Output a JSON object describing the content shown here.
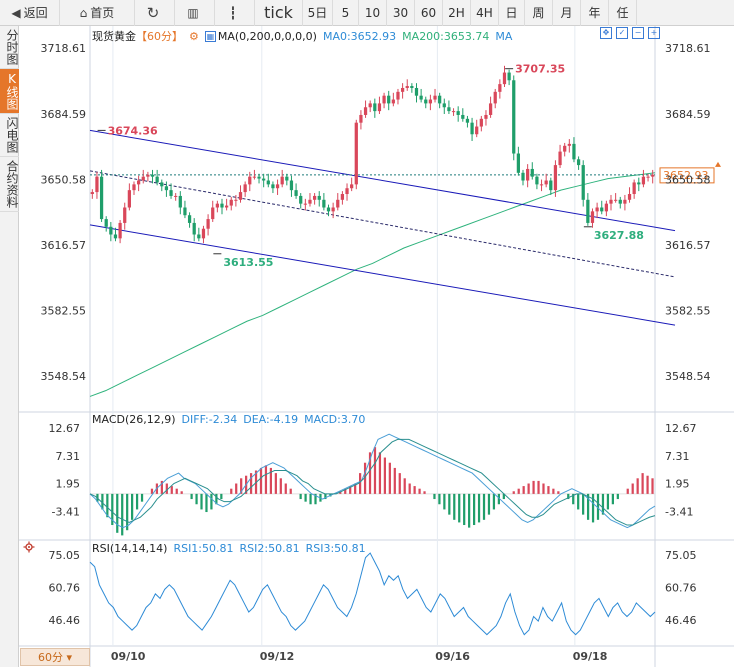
{
  "toolbar": {
    "back": "返回",
    "home": "首页",
    "refresh_icon": "refresh-icon",
    "periods": [
      "tick",
      "5日",
      "5",
      "10",
      "30",
      "60",
      "2H",
      "4H",
      "日",
      "周",
      "月",
      "年",
      "任"
    ]
  },
  "sidetabs": [
    "分时图",
    "K线图",
    "闪电图",
    "合约资料"
  ],
  "period_chip": "60分 ▾",
  "legend": {
    "instrument": "现货黄金",
    "period": "【60分】",
    "ma_label": "MA(0,200,0,0,0,0)",
    "ma0": "MA0:3652.93",
    "ma200": "MA200:3653.74",
    "ma_tail": "MA",
    "macd_label": "MACD(26,12,9)",
    "diff": "DIFF:-2.34",
    "dea": "DEA:-4.19",
    "macd_val": "MACD:3.70",
    "rsi_label": "RSI(14,14,14)",
    "rsi1": "RSI1:50.81",
    "rsi2": "RSI2:50.81",
    "rsi3": "RSI3:50.81"
  },
  "colors": {
    "up": "#d9475a",
    "down": "#1f9e6a",
    "ma200": "#2fb37d",
    "channel": "#1a1ab8",
    "diff": "#4a9ed6",
    "dea": "#2a8f8f",
    "rsi": "#2e8bd6",
    "price_line": "#1c7a7a",
    "current_tag": "#e5762a"
  },
  "chart_data": [
    {
      "type": "candlestick",
      "title": "现货黄金 60分",
      "price_axis_ticks": [
        3718.61,
        3684.59,
        3650.58,
        3616.57,
        3582.55,
        3548.54
      ],
      "ylim": [
        3532,
        3726
      ],
      "date_labels": [
        "09/10",
        "09/12",
        "09/16",
        "09/18"
      ],
      "date_label_bars": [
        6,
        45,
        91,
        127
      ],
      "bar_count": 148,
      "closes": [
        3644,
        3652,
        3630,
        3626,
        3622,
        3620,
        3628,
        3636,
        3645,
        3648,
        3650,
        3652,
        3653,
        3652,
        3649,
        3647,
        3645,
        3642,
        3642,
        3636,
        3632,
        3628,
        3622,
        3620,
        3625,
        3630,
        3636,
        3638,
        3636,
        3637,
        3640,
        3640,
        3644,
        3648,
        3652,
        3652,
        3651,
        3650,
        3648,
        3646,
        3648,
        3652,
        3650,
        3645,
        3642,
        3638,
        3638,
        3640,
        3642,
        3640,
        3636,
        3634,
        3636,
        3640,
        3643,
        3646,
        3648,
        3680,
        3684,
        3688,
        3690,
        3686,
        3690,
        3694,
        3690,
        3692,
        3696,
        3698,
        3699,
        3698,
        3694,
        3692,
        3690,
        3692,
        3694,
        3690,
        3688,
        3686,
        3686,
        3684,
        3682,
        3680,
        3674,
        3678,
        3682,
        3684,
        3690,
        3696,
        3700,
        3706,
        3702,
        3664,
        3654,
        3650,
        3656,
        3652,
        3648,
        3648,
        3650,
        3645,
        3658,
        3665,
        3668,
        3669,
        3661,
        3658,
        3640,
        3628,
        3634,
        3636,
        3634,
        3638,
        3640,
        3640,
        3638,
        3640,
        3643,
        3649,
        3648,
        3652,
        3652,
        3653
      ],
      "series_close_note": "closes are approximate hourly closes read from the candles",
      "annotations": [
        {
          "label": "3674.36",
          "kind": "high"
        },
        {
          "label": "3613.55",
          "kind": "low"
        },
        {
          "label": "3707.35",
          "kind": "high"
        },
        {
          "label": "3627.88",
          "kind": "low"
        }
      ],
      "current_price": "3652.93",
      "ma200": [
        3538,
        3541,
        3545,
        3549,
        3553,
        3557,
        3561,
        3565,
        3569,
        3573,
        3577,
        3580,
        3584,
        3588,
        3592,
        3596,
        3600,
        3604,
        3607,
        3611,
        3615,
        3618,
        3621,
        3624,
        3627,
        3630,
        3633,
        3636,
        3639,
        3642,
        3645,
        3647,
        3649,
        3651,
        3652,
        3653,
        3654
      ],
      "channel": {
        "upper": [
          3676,
          3624
        ],
        "lower": [
          3627,
          3575
        ],
        "middle": [
          3655,
          3600
        ]
      }
    },
    {
      "type": "bar",
      "title": "MACD(26,12,9)",
      "yticks": [
        12.67,
        7.31,
        1.95,
        -3.41
      ],
      "ylim": [
        -8.5,
        15
      ],
      "values": [
        0,
        -1.5,
        -3,
        -4.5,
        -6,
        -7.5,
        -8,
        -7,
        -5,
        -3,
        -1.5,
        0,
        1,
        2,
        2.5,
        2,
        1.5,
        1,
        0.5,
        0,
        -1,
        -2,
        -3,
        -3.5,
        -3,
        -2,
        -1,
        0,
        1,
        2,
        3,
        3.5,
        4,
        4.5,
        5,
        5.5,
        5,
        4,
        3,
        2,
        1,
        0,
        -1,
        -1.5,
        -2,
        -2,
        -1.5,
        -1,
        -0.5,
        0,
        0.5,
        1,
        1.5,
        2,
        4,
        6,
        8,
        9,
        8,
        7,
        6,
        5,
        4,
        3,
        2,
        1.5,
        1,
        0.5,
        0,
        -1,
        -2,
        -3,
        -4,
        -5,
        -5.5,
        -6,
        -6.5,
        -6,
        -5.5,
        -5,
        -4,
        -3,
        -2,
        -1,
        0,
        0.5,
        1,
        1.5,
        2,
        2.5,
        2.5,
        2,
        1.5,
        1,
        0.5,
        0,
        -1,
        -2,
        -3,
        -4,
        -5,
        -5.5,
        -5,
        -4,
        -3,
        -2,
        -1,
        0,
        1,
        2,
        3,
        4,
        3.5,
        3
      ],
      "diff": [
        0,
        -1,
        -2.5,
        -4,
        -5,
        -6,
        -6.5,
        -6,
        -5,
        -3.5,
        -2,
        -0.5,
        1,
        2,
        3,
        3.5,
        4,
        3,
        2.5,
        2,
        1,
        0,
        -1,
        -2,
        -2.5,
        -2,
        -1,
        0,
        1.5,
        3,
        4,
        5,
        5.5,
        6,
        5.5,
        5,
        4,
        3,
        2,
        1,
        0,
        -0.5,
        -1,
        -0.5,
        0,
        0.5,
        1,
        1.5,
        2,
        2.5,
        5,
        8,
        10.5,
        11,
        11.5,
        11,
        10.5,
        10,
        9.5,
        9,
        8.5,
        8,
        7.5,
        7,
        6.5,
        6,
        5.5,
        5,
        4.5,
        4,
        3,
        2,
        1,
        0,
        -1,
        -2,
        -3,
        -4,
        -5,
        -5.5,
        -5,
        -4,
        -3,
        -2,
        -1,
        0,
        0.5,
        1,
        0.5,
        0,
        -1,
        -2,
        -3,
        -4,
        -5,
        -5.5,
        -6,
        -6.5,
        -6,
        -5,
        -4,
        -3,
        -2.34
      ],
      "dea": [
        0,
        -0.5,
        -1.5,
        -2.5,
        -3.5,
        -4.5,
        -5,
        -5.5,
        -5,
        -4.5,
        -3.5,
        -2.5,
        -1,
        0,
        1,
        2,
        2.5,
        3,
        2.5,
        2,
        1.5,
        1,
        0,
        -1,
        -1.5,
        -1.5,
        -1,
        -0.5,
        0.5,
        1.5,
        2.5,
        3.5,
        4,
        4.5,
        4.5,
        4.5,
        4,
        3.5,
        2.5,
        2,
        1,
        0.5,
        0,
        0,
        0,
        0.5,
        1,
        1.5,
        2,
        3,
        4.5,
        6,
        8,
        9,
        10,
        10.5,
        10.5,
        10.5,
        10,
        9.5,
        9,
        8.5,
        8,
        7.5,
        7,
        6.5,
        6,
        5.5,
        5,
        4.5,
        4,
        3,
        2,
        1,
        0,
        -1,
        -2,
        -3,
        -4,
        -4.5,
        -4.5,
        -4,
        -3,
        -2,
        -1.5,
        -1,
        -0.5,
        0,
        0,
        -0.5,
        -1,
        -2,
        -3,
        -4,
        -5,
        -5.5,
        -6,
        -6,
        -5.5,
        -5,
        -4.5,
        -4.19
      ]
    },
    {
      "type": "line",
      "title": "RSI(14,14,14)",
      "yticks": [
        75.05,
        60.76,
        46.46
      ],
      "ylim": [
        35,
        80
      ],
      "values": [
        72,
        70,
        62,
        58,
        54,
        52,
        48,
        46,
        44,
        42,
        44,
        48,
        52,
        54,
        58,
        56,
        60,
        62,
        60,
        56,
        52,
        48,
        46,
        44,
        42,
        45,
        48,
        52,
        56,
        60,
        64,
        62,
        58,
        54,
        50,
        52,
        56,
        60,
        62,
        58,
        54,
        50,
        48,
        44,
        42,
        44,
        46,
        50,
        54,
        58,
        62,
        60,
        56,
        52,
        50,
        48,
        52,
        58,
        66,
        74,
        76,
        72,
        68,
        62,
        66,
        64,
        66,
        60,
        56,
        58,
        60,
        56,
        52,
        50,
        54,
        58,
        56,
        52,
        48,
        50,
        52,
        48,
        46,
        44,
        42,
        40,
        42,
        44,
        48,
        54,
        58,
        50,
        44,
        40,
        42,
        48,
        46,
        52,
        48,
        46,
        50,
        54,
        46,
        42,
        40,
        42,
        46,
        50,
        54,
        56,
        52,
        48,
        52,
        54,
        50,
        48,
        50,
        54,
        52,
        50,
        48,
        50
      ]
    }
  ]
}
